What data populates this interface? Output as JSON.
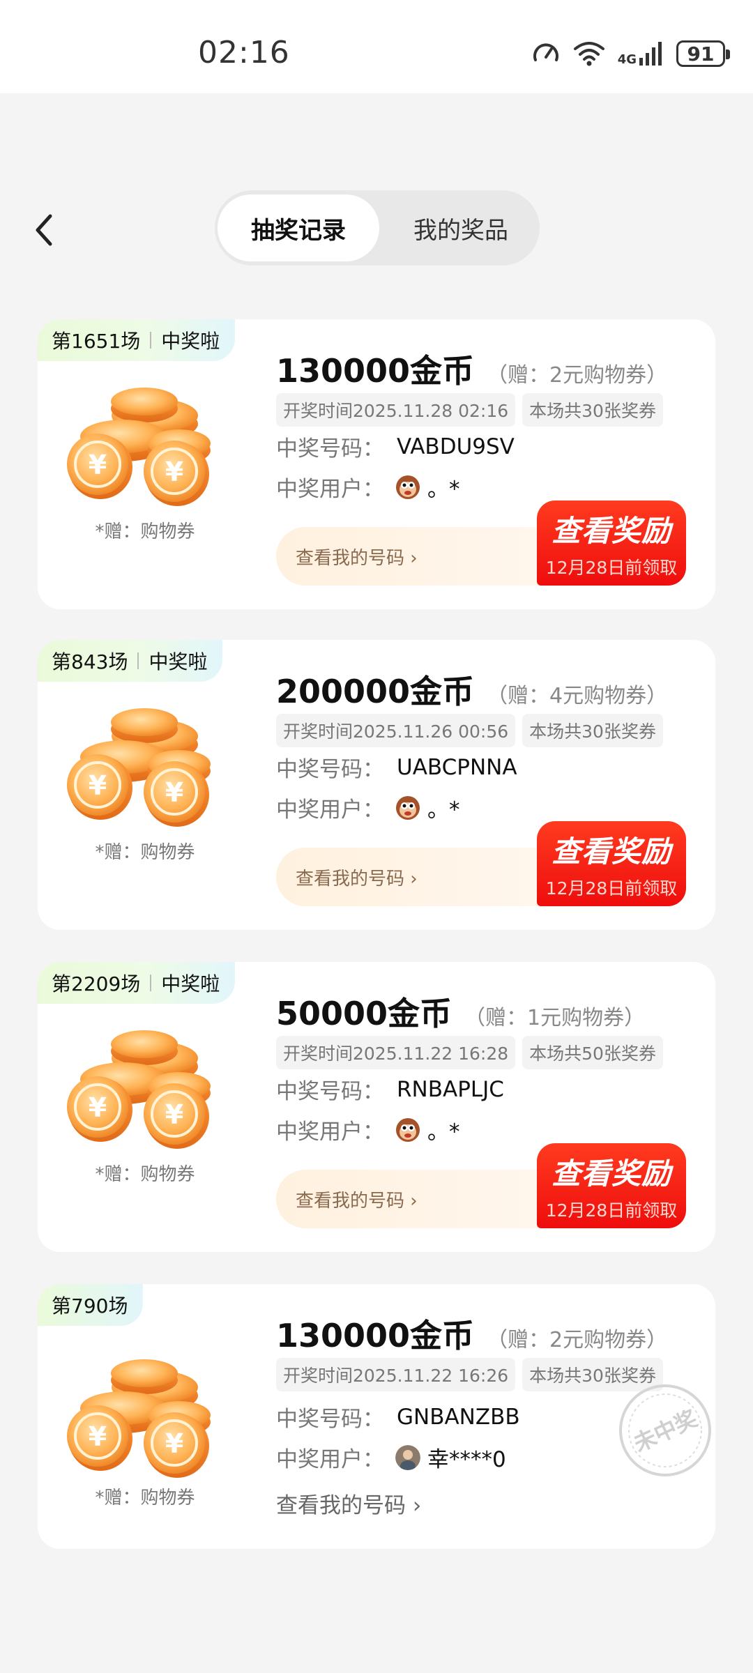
{
  "status_bar": {
    "time": "02:16",
    "network": "4G",
    "battery": "91"
  },
  "header": {
    "tabs": [
      {
        "label": "抽奖记录",
        "active": true
      },
      {
        "label": "我的奖品",
        "active": false
      }
    ]
  },
  "records": [
    {
      "round": "第1651场",
      "status": "中奖啦",
      "prize": "130000金币",
      "bonus": "（赠：2元购物券）",
      "draw_time": "开奖时间2025.11.28 02:16",
      "ticket_count": "本场共30张奖券",
      "code_label": "中奖号码：",
      "code": "VABDU9SV",
      "user_label": "中奖用户：",
      "user": "。*",
      "gift_note": "*赠：购物券",
      "my_code_link": "查看我的号码 ›",
      "reward_button": "查看奖励",
      "reward_deadline": "12月28日前领取"
    },
    {
      "round": "第843场",
      "status": "中奖啦",
      "prize": "200000金币",
      "bonus": "（赠：4元购物券）",
      "draw_time": "开奖时间2025.11.26 00:56",
      "ticket_count": "本场共30张奖券",
      "code_label": "中奖号码：",
      "code": "UABCPNNA",
      "user_label": "中奖用户：",
      "user": "。*",
      "gift_note": "*赠：购物券",
      "my_code_link": "查看我的号码 ›",
      "reward_button": "查看奖励",
      "reward_deadline": "12月28日前领取"
    },
    {
      "round": "第2209场",
      "status": "中奖啦",
      "prize": "50000金币",
      "bonus": "（赠：1元购物券）",
      "draw_time": "开奖时间2025.11.22 16:28",
      "ticket_count": "本场共50张奖券",
      "code_label": "中奖号码：",
      "code": "RNBAPLJC",
      "user_label": "中奖用户：",
      "user": "。*",
      "gift_note": "*赠：购物券",
      "my_code_link": "查看我的号码 ›",
      "reward_button": "查看奖励",
      "reward_deadline": "12月28日前领取"
    },
    {
      "round": "第790场",
      "prize": "130000金币",
      "bonus": "（赠：2元购物券）",
      "draw_time": "开奖时间2025.11.22 16:26",
      "ticket_count": "本场共30张奖券",
      "code_label": "中奖号码：",
      "code": "GNBANZBB",
      "user_label": "中奖用户：",
      "user": "幸****0",
      "gift_note": "*赠：购物券",
      "my_code_link": "查看我的号码 ›",
      "stamp": "未中奖"
    }
  ],
  "colors": {
    "accent_red": "#ee0d0d",
    "page_bg": "#f4f4f4"
  }
}
